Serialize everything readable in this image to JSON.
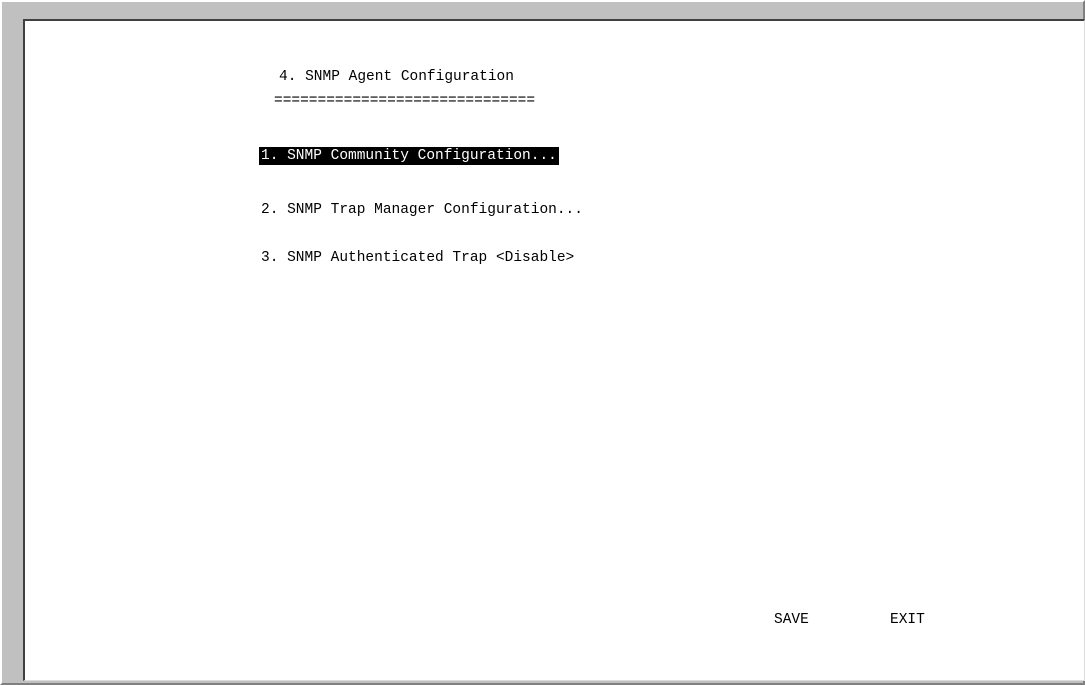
{
  "screen": {
    "title": "4. SNMP Agent Configuration",
    "underline": "=============================="
  },
  "menu": {
    "items": [
      {
        "label": "1. SNMP Community Configuration...",
        "selected": true
      },
      {
        "label": "2. SNMP Trap Manager Configuration...",
        "selected": false
      },
      {
        "label": "3. SNMP Authenticated Trap <Disable>",
        "selected": false
      }
    ]
  },
  "actions": {
    "save_label": "SAVE",
    "exit_label": "EXIT"
  },
  "colors": {
    "selection_bg": "#000000",
    "selection_fg": "#ffffff",
    "terminal_bg": "#ffffff",
    "frame_bg": "#c0c0c0"
  }
}
